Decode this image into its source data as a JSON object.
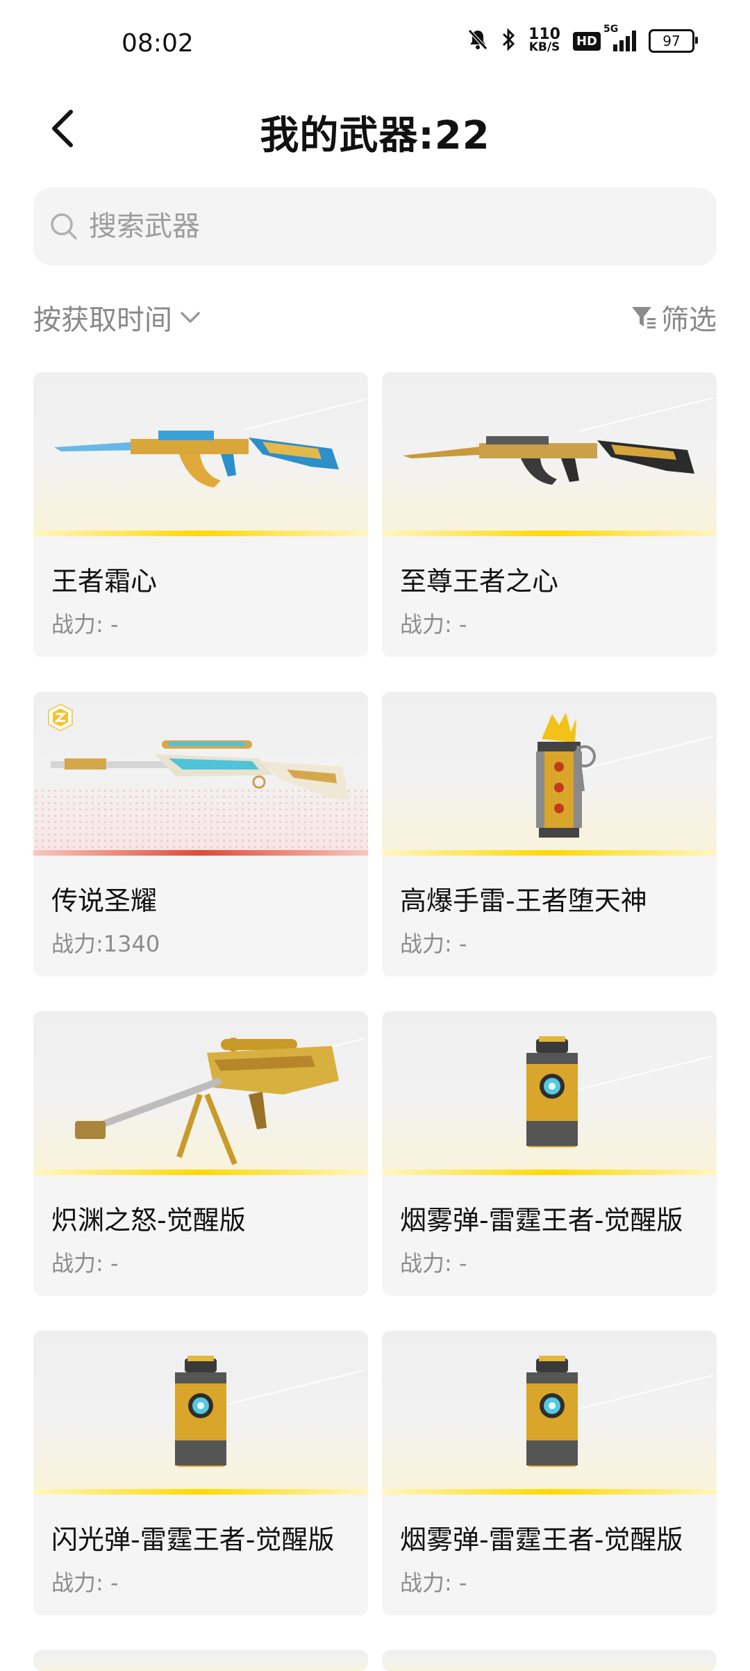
{
  "status_bar": {
    "time": "08:02",
    "net_speed_value": "110",
    "net_speed_unit": "KB/S",
    "hd_label": "HD",
    "signal_label": "5G",
    "battery": "97"
  },
  "header": {
    "title": "我的武器:22"
  },
  "search": {
    "placeholder": "搜索武器"
  },
  "toolbar": {
    "sort_label": "按获取时间",
    "filter_label": "筛选"
  },
  "weapons": [
    {
      "name": "王者霜心",
      "power": "战力: -",
      "icon": "rifle-blue-gold",
      "rarity_color": "#ffd800"
    },
    {
      "name": "至尊王者之心",
      "power": "战力: -",
      "icon": "rifle-black-gold",
      "rarity_color": "#ffd800"
    },
    {
      "name": "传说圣耀",
      "power": "战力:1340",
      "icon": "sniper-white-gold",
      "rarity_color": "#e04a34"
    },
    {
      "name": "高爆手雷-王者堕天神",
      "power": "战力: -",
      "icon": "grenade-gold",
      "rarity_color": "#ffd800"
    },
    {
      "name": "炽渊之怒-觉醒版",
      "power": "战力: -",
      "icon": "sniper-gold-bipod",
      "rarity_color": "#ffd800"
    },
    {
      "name": "烟雾弹-雷霆王者-觉醒版",
      "power": "战力: -",
      "icon": "smoke-grenade",
      "rarity_color": "#ffd800"
    },
    {
      "name": "闪光弹-雷霆王者-觉醒版",
      "power": "战力: -",
      "icon": "flash-grenade",
      "rarity_color": "#ffd800"
    },
    {
      "name": "烟雾弹-雷霆王者-觉醒版",
      "power": "战力: -",
      "icon": "smoke-grenade",
      "rarity_color": "#ffd800"
    }
  ]
}
